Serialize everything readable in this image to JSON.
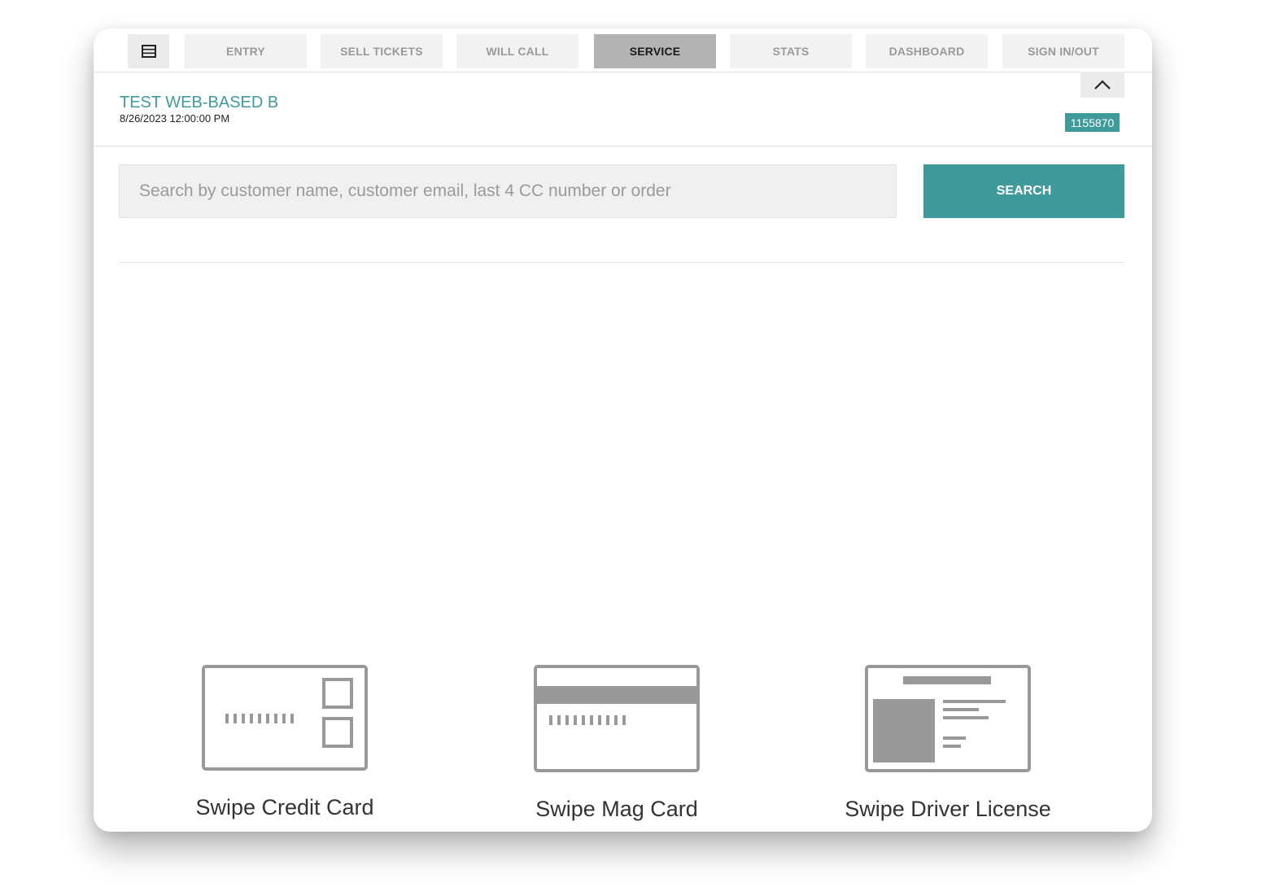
{
  "nav": {
    "menu_icon": "list-icon",
    "tabs": [
      {
        "label": "ENTRY",
        "active": false
      },
      {
        "label": "SELL TICKETS",
        "active": false
      },
      {
        "label": "WILL CALL",
        "active": false
      },
      {
        "label": "SERVICE",
        "active": true
      },
      {
        "label": "STATS",
        "active": false
      },
      {
        "label": "DASHBOARD",
        "active": false
      },
      {
        "label": "SIGN IN/OUT",
        "active": false
      }
    ]
  },
  "header": {
    "event_title": "TEST WEB-BASED B",
    "event_datetime": "8/26/2023 12:00:00 PM",
    "id_badge": "1155870",
    "collapse_icon": "chevron-up-icon"
  },
  "search": {
    "placeholder": "Search by customer name, customer email, last 4 CC number or order",
    "value": "",
    "button_label": "SEARCH"
  },
  "swipe_options": [
    {
      "label": "Swipe Credit Card",
      "icon": "credit-card-icon"
    },
    {
      "label": "Swipe Mag Card",
      "icon": "mag-card-icon"
    },
    {
      "label": "Swipe Driver License",
      "icon": "driver-license-icon"
    }
  ],
  "colors": {
    "accent": "#3f9b9b",
    "icon_gray": "#999999",
    "active_tab": "#b3b3b3"
  }
}
